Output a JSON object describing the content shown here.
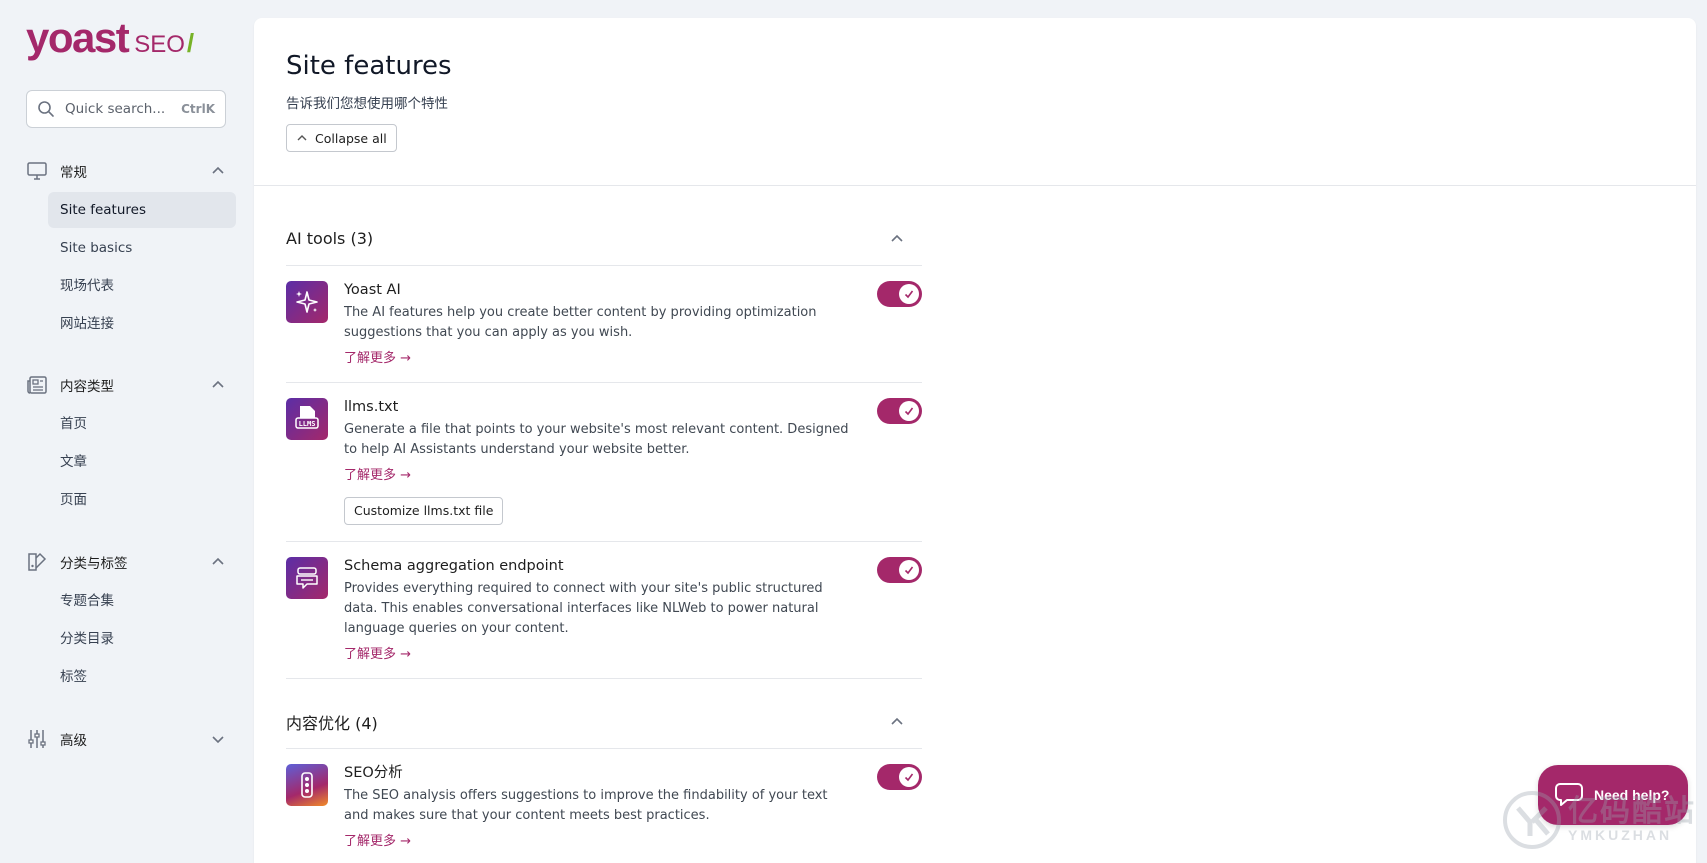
{
  "brand": {
    "name": "yoast",
    "product": "SEO",
    "slash": "/"
  },
  "search": {
    "placeholder": "Quick search...",
    "shortcut": "CtrlK"
  },
  "sidebar": {
    "groups": [
      {
        "title": "常规",
        "icon": "monitor-icon",
        "expanded": true,
        "items": [
          {
            "label": "Site features",
            "active": true
          },
          {
            "label": "Site basics",
            "active": false
          },
          {
            "label": "现场代表",
            "active": false
          },
          {
            "label": "网站连接",
            "active": false
          }
        ]
      },
      {
        "title": "内容类型",
        "icon": "newspaper-icon",
        "expanded": true,
        "items": [
          {
            "label": "首页"
          },
          {
            "label": "文章"
          },
          {
            "label": "页面"
          }
        ]
      },
      {
        "title": "分类与标签",
        "icon": "tag-icon",
        "expanded": true,
        "items": [
          {
            "label": "专题合集"
          },
          {
            "label": "分类目录"
          },
          {
            "label": "标签"
          }
        ]
      },
      {
        "title": "高级",
        "icon": "sliders-icon",
        "expanded": false,
        "items": []
      }
    ]
  },
  "page": {
    "title": "Site features",
    "subtitle": "告诉我们您想使用哪个特性",
    "collapse_all": "Collapse all"
  },
  "sections": [
    {
      "title": "AI tools (3)",
      "features": [
        {
          "title": "Yoast AI",
          "icon": "sparkles-icon",
          "description": "The AI features help you create better content by providing optimization suggestions that you can apply as you wish.",
          "link": "了解更多 →",
          "enabled": true
        },
        {
          "title": "llms.txt",
          "icon": "llms-file-icon",
          "description": "Generate a file that points to your website's most relevant content. Designed to help AI Assistants understand your website better.",
          "link": "了解更多 →",
          "extra_button": "Customize llms.txt file",
          "enabled": true
        },
        {
          "title": "Schema aggregation endpoint",
          "icon": "schema-chat-icon",
          "description": "Provides everything required to connect with your site's public structured data. This enables conversational interfaces like NLWeb to power natural language queries on your content.",
          "link": "了解更多 →",
          "enabled": true
        }
      ]
    },
    {
      "title": "内容优化 (4)",
      "features": [
        {
          "title": "SEO分析",
          "icon": "traffic-light-icon",
          "description": "The SEO analysis offers suggestions to improve the findability of your text and makes sure that your content meets best practices.",
          "link": "了解更多 →",
          "enabled": true
        }
      ]
    }
  ],
  "help": {
    "label": "Need help?"
  },
  "watermark": {
    "cn": "亿码酷站",
    "en": "YMKUZHAN"
  },
  "colors": {
    "brand": "#a4286a",
    "accent_green": "#77b227",
    "background": "#f0f3f7"
  }
}
